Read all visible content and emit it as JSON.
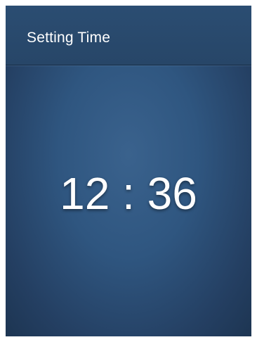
{
  "header": {
    "title": "Setting Time"
  },
  "time": {
    "hours": "12",
    "separator": ":",
    "minutes": "36"
  },
  "colors": {
    "background": "#2f5680",
    "header": "#274668",
    "text": "#ffffff"
  }
}
